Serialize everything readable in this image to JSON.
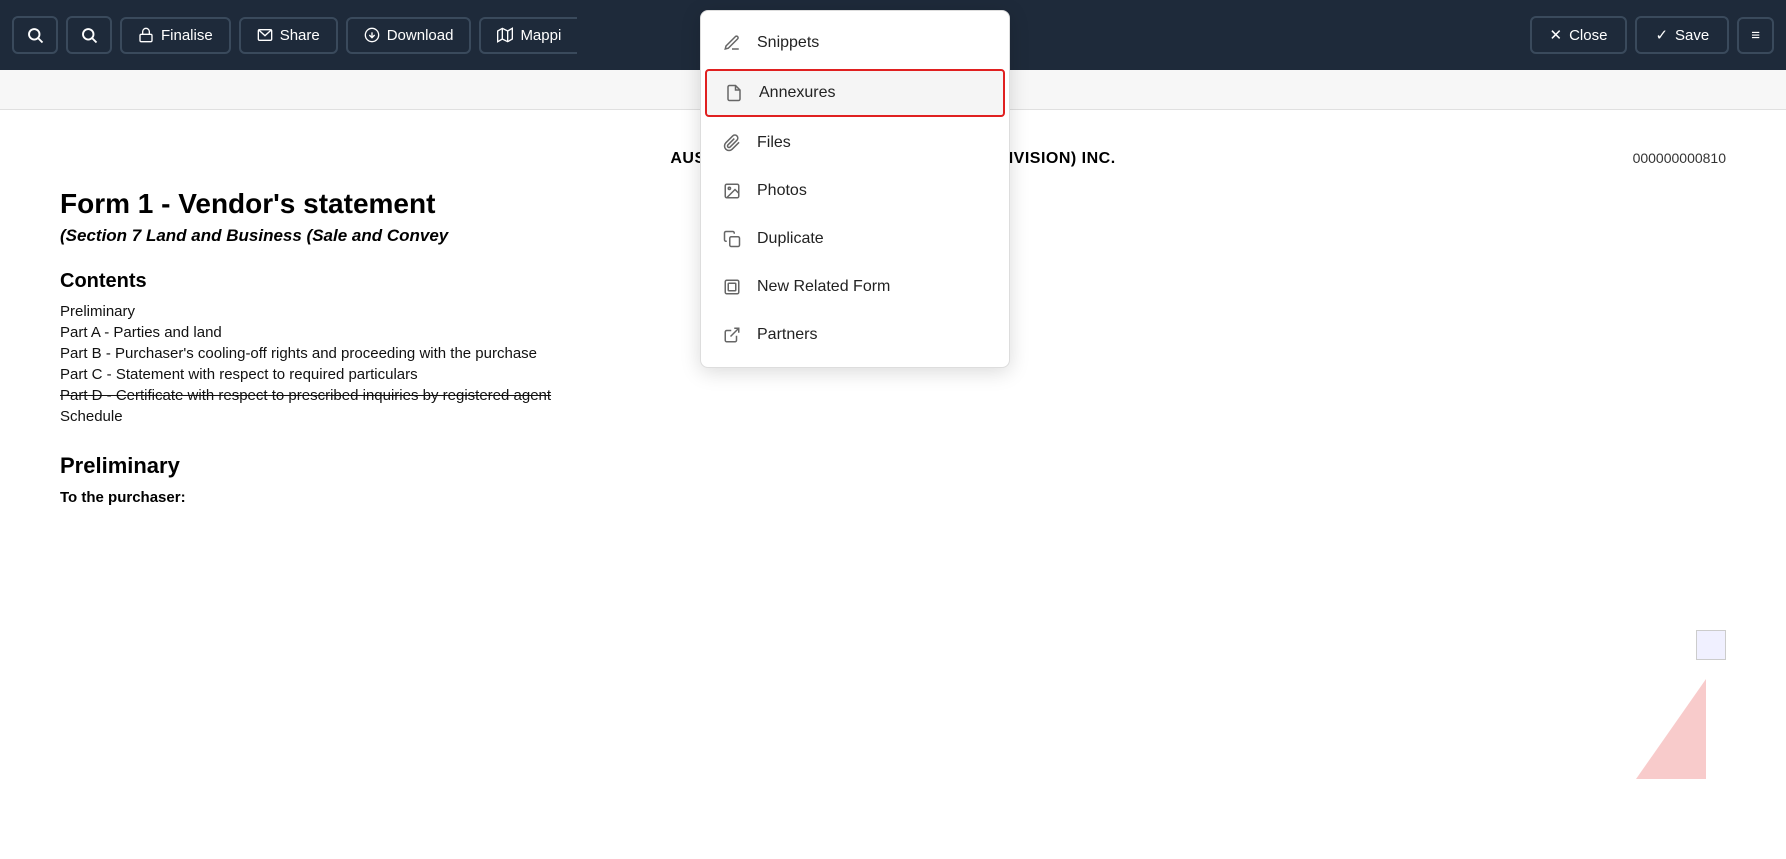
{
  "toolbar": {
    "search1_label": "",
    "search2_label": "",
    "finalise_label": "Finalise",
    "share_label": "Share",
    "download_label": "Download",
    "mapping_label": "Mappi",
    "close_label": "Close",
    "save_label": "Save"
  },
  "dropdown": {
    "items": [
      {
        "id": "snippets",
        "label": "Snippets",
        "icon": "pencil"
      },
      {
        "id": "annexures",
        "label": "Annexures",
        "icon": "file",
        "highlighted": true
      },
      {
        "id": "files",
        "label": "Files",
        "icon": "clip"
      },
      {
        "id": "photos",
        "label": "Photos",
        "icon": "photo"
      },
      {
        "id": "duplicate",
        "label": "Duplicate",
        "icon": "copy"
      },
      {
        "id": "new-related-form",
        "label": "New Related Form",
        "icon": "newform"
      },
      {
        "id": "partners",
        "label": "Partners",
        "icon": "partner"
      }
    ]
  },
  "document": {
    "header": "AUSTRALIAN INSTITUTE OF CONVI          IAN DIVISION) INC.",
    "doc_id": "000000000810",
    "form_title": "Form 1 - Vendor's statement",
    "form_subtitle": "(Section 7 Land and Business (Sale and Convey",
    "contents_heading": "Contents",
    "contents_items": [
      {
        "text": "Preliminary",
        "strikethrough": false
      },
      {
        "text": "Part A - Parties and land",
        "strikethrough": false
      },
      {
        "text": "Part B - Purchaser's cooling-off rights and proceeding with the purchase",
        "strikethrough": false
      },
      {
        "text": "Part C - Statement with respect to required particulars",
        "strikethrough": false
      },
      {
        "text": "Part D - Certificate with respect to prescribed inquiries by registered agent",
        "strikethrough": true
      },
      {
        "text": "Schedule",
        "strikethrough": false
      }
    ],
    "preliminary_heading": "Preliminary",
    "to_purchaser": "To the purchaser:"
  }
}
